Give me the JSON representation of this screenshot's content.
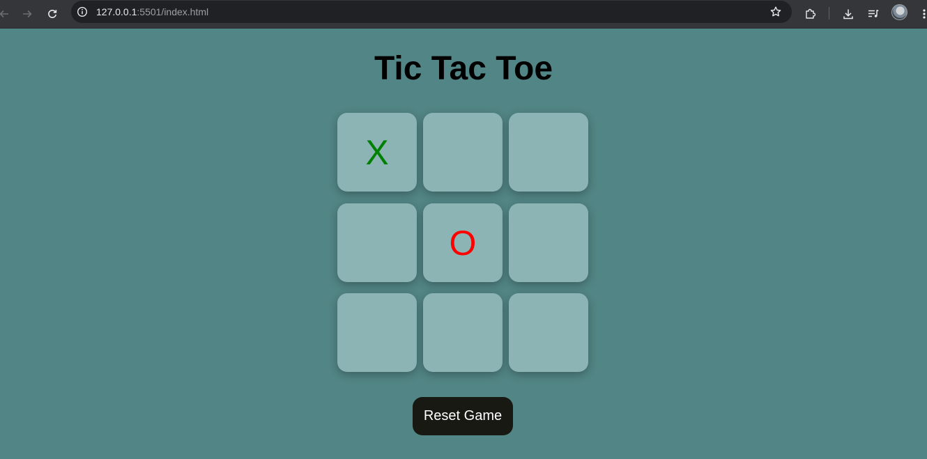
{
  "browser": {
    "url_host": "127.0.0.1",
    "url_rest": ":5501/index.html"
  },
  "page": {
    "title": "Tic Tac Toe",
    "reset_label": "Reset Game"
  },
  "board": {
    "cells": [
      "X",
      "",
      "",
      "",
      "O",
      "",
      "",
      "",
      ""
    ]
  },
  "colors": {
    "background": "#528585",
    "cell": "#8db4b4",
    "x_mark": "#008000",
    "o_mark": "#ff0000",
    "button": "#191913"
  }
}
